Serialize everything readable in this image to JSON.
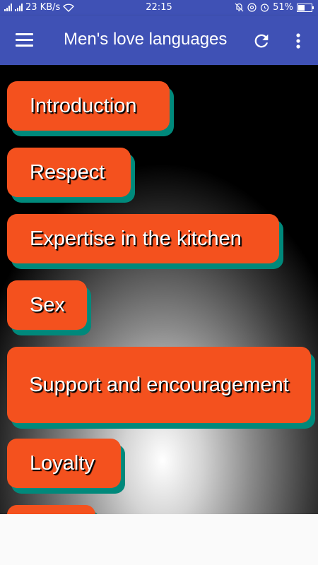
{
  "status_bar": {
    "network_speed": "23 KB/s",
    "time": "22:15",
    "battery": "51%",
    "battery_level": 0.51
  },
  "app_bar": {
    "title": "Men's love languages",
    "menu_icon": "hamburger-menu-icon",
    "refresh_icon": "refresh-icon",
    "more_icon": "more-vert-icon"
  },
  "colors": {
    "primary": "#3f51b5",
    "item_background": "#f4511e",
    "item_shadow": "#00897b"
  },
  "list": {
    "items": [
      {
        "label": "Introduction"
      },
      {
        "label": "Respect"
      },
      {
        "label": "Expertise in the kitchen"
      },
      {
        "label": "Sex"
      },
      {
        "label": "Support and encouragement"
      },
      {
        "label": "Loyalty"
      },
      {
        "label": ""
      }
    ]
  }
}
